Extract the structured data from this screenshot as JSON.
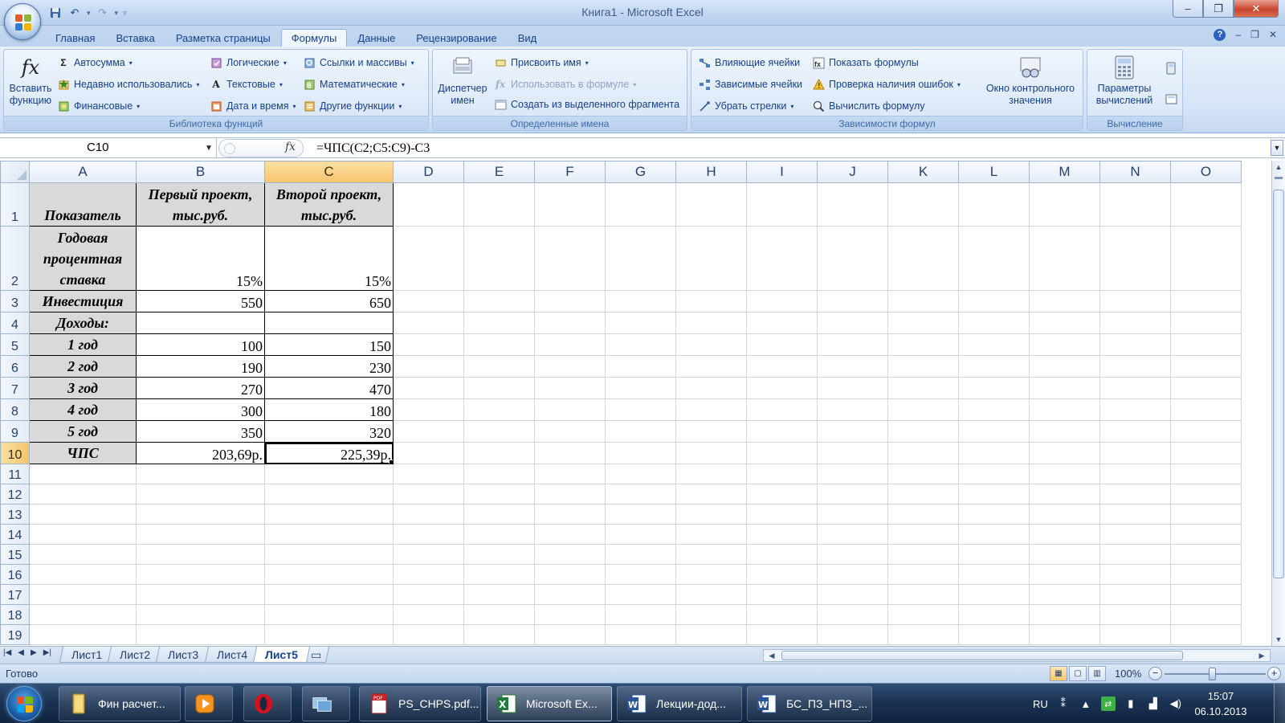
{
  "window": {
    "title": "Книга1 - Microsoft Excel",
    "minimize_glyph": "–",
    "restore_glyph": "❐",
    "close_glyph": "✕"
  },
  "qat": {
    "save_icon": "save-icon",
    "undo_icon": "undo-icon",
    "redo_icon": "redo-icon",
    "customize_icon": "customize-qat-icon"
  },
  "ribbon_tabs": [
    "Главная",
    "Вставка",
    "Разметка страницы",
    "Формулы",
    "Данные",
    "Рецензирование",
    "Вид"
  ],
  "active_tab_index": 3,
  "ribbon": {
    "function_library": {
      "label": "Библиотека функций",
      "insert_function": [
        "Вставить",
        "функцию"
      ],
      "autosum": "Автосумма",
      "recently_used": "Недавно использовались",
      "financial": "Финансовые",
      "logical": "Логические",
      "text": "Текстовые",
      "date_time": "Дата и время",
      "lookup": "Ссылки и массивы",
      "math": "Математические",
      "more": "Другие функции"
    },
    "defined_names": {
      "label": "Определенные имена",
      "name_manager": [
        "Диспетчер",
        "имен"
      ],
      "define_name": "Присвоить имя",
      "use_in_formula": "Использовать в формуле",
      "create_from_selection": "Создать из выделенного фрагмента"
    },
    "formula_auditing": {
      "label": "Зависимости формул",
      "trace_precedents": "Влияющие ячейки",
      "trace_dependents": "Зависимые ячейки",
      "remove_arrows": "Убрать стрелки",
      "show_formulas": "Показать формулы",
      "error_checking": "Проверка наличия ошибок",
      "evaluate_formula": "Вычислить формулу",
      "watch_window": [
        "Окно контрольного",
        "значения"
      ]
    },
    "calculation": {
      "label": "Вычисление",
      "calc_options": [
        "Параметры",
        "вычислений"
      ]
    }
  },
  "formula_bar": {
    "name_box": "C10",
    "fx": "fx",
    "formula": "=ЧПС(C2;C5:C9)-C3"
  },
  "columns": [
    "A",
    "B",
    "C",
    "D",
    "E",
    "F",
    "G",
    "H",
    "I",
    "J",
    "K",
    "L",
    "M",
    "N",
    "O"
  ],
  "selected_column": "C",
  "rows": [
    "1",
    "2",
    "3",
    "4",
    "5",
    "6",
    "7",
    "8",
    "9",
    "10",
    "11",
    "12",
    "13",
    "14",
    "15",
    "16",
    "17",
    "18",
    "19"
  ],
  "selected_row": "10",
  "table": {
    "header": [
      "Показатель",
      "Первый проект, тыс.руб.",
      "Второй проект, тыс.руб."
    ],
    "body": [
      [
        "Годовая процентная ставка",
        "15%",
        "15%"
      ],
      [
        "Инвестиция",
        "550",
        "650"
      ],
      [
        "Доходы:",
        "",
        ""
      ],
      [
        "1 год",
        "100",
        "150"
      ],
      [
        "2 год",
        "190",
        "230"
      ],
      [
        "3 год",
        "270",
        "470"
      ],
      [
        "4 год",
        "300",
        "180"
      ],
      [
        "5 год",
        "350",
        "320"
      ],
      [
        "ЧПС",
        "203,69р.",
        "225,39р."
      ]
    ]
  },
  "sheets": [
    "Лист1",
    "Лист2",
    "Лист3",
    "Лист4",
    "Лист5"
  ],
  "active_sheet_index": 4,
  "status": {
    "text": "Готово",
    "zoom": "100%"
  },
  "taskbar": {
    "items": [
      {
        "label": "Фин расчет...",
        "icon": "folder-icon"
      },
      {
        "label": "",
        "icon": "media-player-icon"
      },
      {
        "label": "",
        "icon": "opera-icon"
      },
      {
        "label": "",
        "icon": "pictures-icon"
      },
      {
        "label": "PS_CHPS.pdf...",
        "icon": "pdf-icon"
      },
      {
        "label": "Microsoft Ex...",
        "icon": "excel-icon"
      },
      {
        "label": "Лекции-дод...",
        "icon": "word-icon"
      },
      {
        "label": "БС_ПЗ_НПЗ_...",
        "icon": "word-icon"
      }
    ],
    "active_index": 5,
    "lang": "RU",
    "time": "15:07",
    "date": "06.10.2013"
  },
  "colors": {
    "ribbon_text": "#15428b",
    "header_fill": "#d9d9d9",
    "selected_header": "#f5c46c"
  }
}
